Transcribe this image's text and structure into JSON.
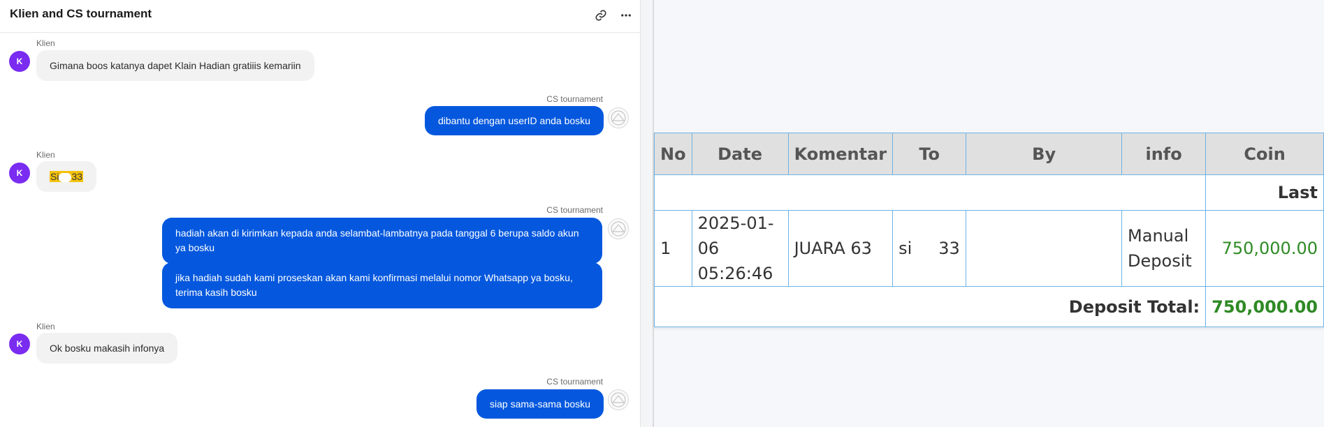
{
  "chat": {
    "title": "Klien and CS tournament",
    "icons": {
      "link": "link-icon",
      "more": "more-options-icon"
    },
    "messages": [
      {
        "sender": "Klien",
        "avatar": "K",
        "text": "Gimana boos katanya dapet Klain Hadian gratiiis kemariin"
      },
      {
        "sender": "CS tournament",
        "text": "dibantu dengan userID anda bosku"
      },
      {
        "sender": "Klien",
        "avatar": "K",
        "text_a": "Si",
        "text_b": "33"
      },
      {
        "sender": "CS tournament",
        "text_1": "hadiah akan di kirimkan kepada anda selambat-lambatnya pada tanggal 6 berupa saldo akun ya bosku",
        "text_2": "jika hadiah sudah kami proseskan akan kami konfirmasi melalui nomor Whatsapp ya bosku, terima kasih bosku"
      },
      {
        "sender": "Klien",
        "avatar": "K",
        "text": "Ok bosku makasih infonya"
      },
      {
        "sender": "CS tournament",
        "text": "siap sama-sama bosku"
      }
    ]
  },
  "report": {
    "columns": [
      "No",
      "Date",
      "Komentar",
      "To",
      "By",
      "info",
      "Coin"
    ],
    "last_label": "Last",
    "row": {
      "no": "1",
      "date_line1": "2025-01-",
      "date_line2": "06",
      "date_line3": "05:26:46",
      "komentar": "JUARA 63",
      "to_a": "si",
      "to_b": "33",
      "by": "",
      "info_line1": "Manual",
      "info_line2": "Deposit",
      "coin": "750,000.00"
    },
    "total_label": "Deposit Total:",
    "total_value": "750,000.00",
    "colors": {
      "border": "#6cb3e6",
      "header_bg": "#e0e0e0",
      "green": "#2e8a24",
      "bubble_out": "#0558de",
      "avatar": "#7a2cf0"
    }
  }
}
